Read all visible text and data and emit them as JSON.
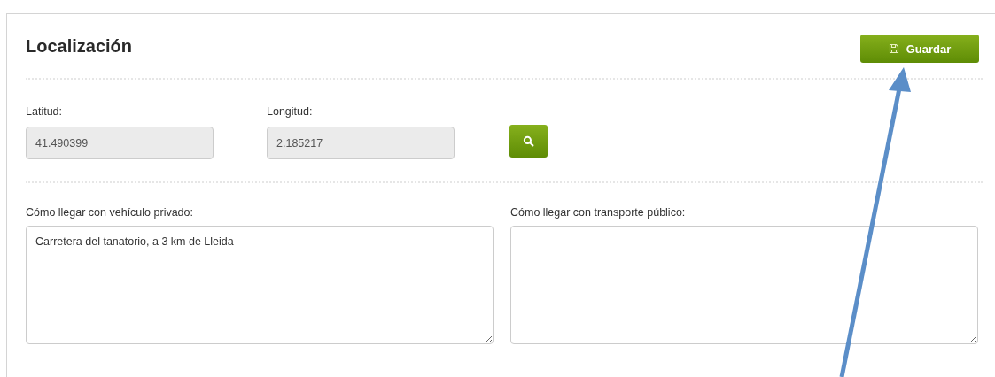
{
  "panel": {
    "title": "Localización",
    "save_button": "Guardar"
  },
  "coordinates": [
    {
      "label": "Latitud:",
      "value": "41.490399",
      "disabled": true
    },
    {
      "label": "Longitud:",
      "value": "2.185217",
      "disabled": true
    }
  ],
  "directions": [
    {
      "label": "Cómo llegar con vehículo privado:",
      "value": "Carretera del tanatorio, a 3 km de Lleida"
    },
    {
      "label": "Cómo llegar con transporte público:"
    }
  ]
}
